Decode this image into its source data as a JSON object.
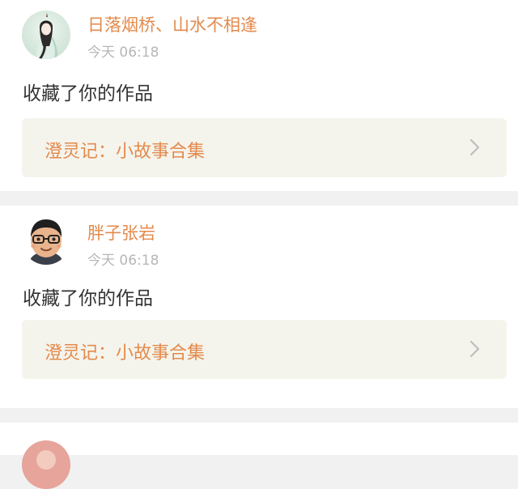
{
  "notifications": [
    {
      "username": "日落烟桥、山水不相逢",
      "time": "今天 06:18",
      "action": "收藏了你的作品",
      "work_title": "澄灵记：小故事合集"
    },
    {
      "username": "胖子张岩",
      "time": "今天 06:18",
      "action": "收藏了你的作品",
      "work_title": "澄灵记：小故事合集"
    }
  ],
  "colors": {
    "accent": "#e48a4c",
    "timestamp": "#b7b7b7",
    "work_box_bg": "#f5f4ec",
    "page_bg": "#f1f1f1"
  }
}
